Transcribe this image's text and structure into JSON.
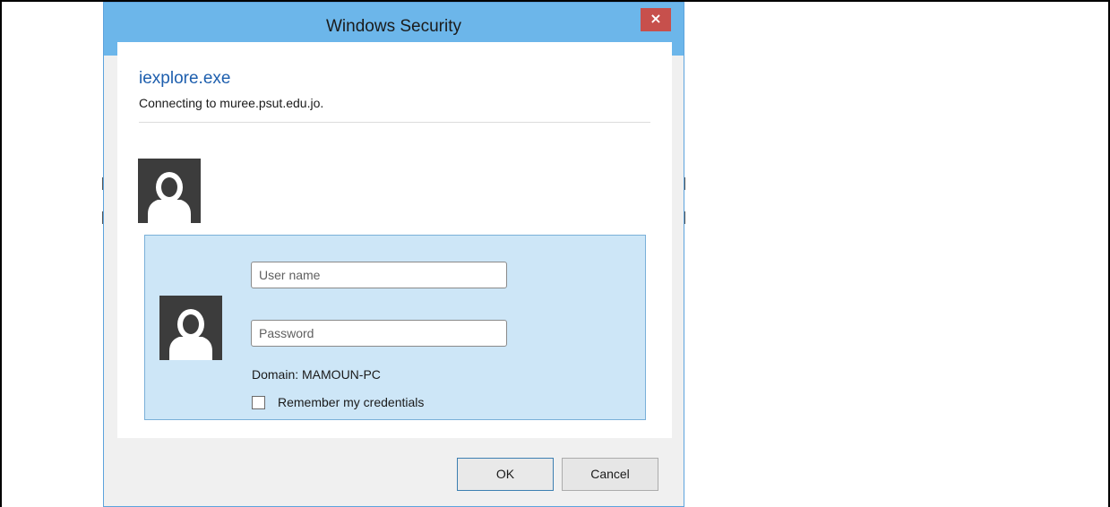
{
  "dialog": {
    "title": "Windows Security",
    "close_glyph": "×",
    "app_name": "iexplore.exe",
    "connecting_text": "Connecting to muree.psut.edu.jo.",
    "username_placeholder": "User name",
    "password_placeholder": "Password",
    "domain_text": "Domain: MAMOUN-PC",
    "remember_label": "Remember my credentials",
    "remember_checked": false,
    "ok_label": "OK",
    "cancel_label": "Cancel"
  },
  "icons": [
    "close-icon",
    "user-avatar-icon"
  ],
  "colors": {
    "titlebar": "#6cb6ea",
    "close_button": "#c7504c",
    "credential_panel": "#cde6f7",
    "app_name": "#1e5fae",
    "avatar": "#3c3c3c"
  }
}
